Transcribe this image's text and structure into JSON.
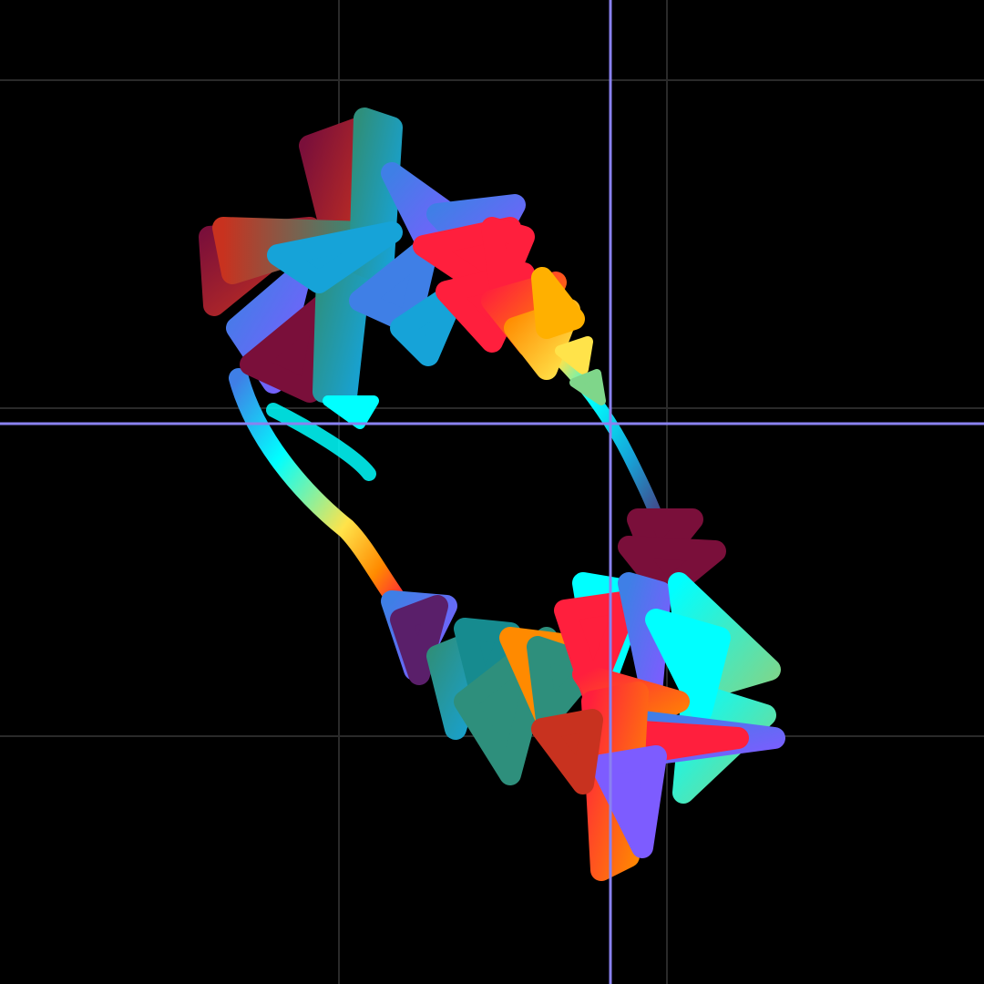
{
  "artwork": {
    "background": "#000000",
    "grid": {
      "visible": true,
      "color": "#2a2a2a"
    },
    "crosshair": {
      "visible": true,
      "color": "#8a82f0"
    },
    "palette": [
      "#ff1f3d",
      "#ff8a00",
      "#ffe34a",
      "#00ffff",
      "#16a3d8",
      "#3f7fe6",
      "#7d5cff",
      "#2e8f7c",
      "#7a0f3a",
      "#c8321f"
    ],
    "clusters": [
      {
        "id": "upper-cluster",
        "dominant_colors": [
          "#c8321f",
          "#2e8f7c",
          "#16a3d8",
          "#7d5cff",
          "#ff1f3d",
          "#ffe34a"
        ]
      },
      {
        "id": "lower-cluster",
        "dominant_colors": [
          "#00ffff",
          "#ff1f3d",
          "#7d5cff",
          "#2e8f7c",
          "#ff8a00",
          "#7a0f3a"
        ]
      }
    ]
  }
}
